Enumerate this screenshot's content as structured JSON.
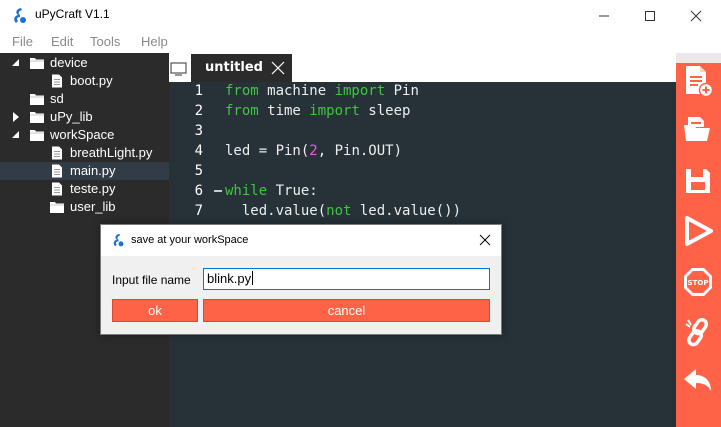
{
  "window": {
    "title": "uPyCraft V1.1"
  },
  "menu": {
    "items": [
      "File",
      "Edit",
      "Tools",
      "Help"
    ]
  },
  "tree": {
    "items": [
      {
        "label": "device",
        "type": "folder",
        "expanded": true,
        "level": 0
      },
      {
        "label": "boot.py",
        "type": "file",
        "level": 1
      },
      {
        "label": "sd",
        "type": "folder",
        "expanded": false,
        "level": 0,
        "no_arrow": true
      },
      {
        "label": "uPy_lib",
        "type": "folder",
        "expanded": false,
        "level": 0
      },
      {
        "label": "workSpace",
        "type": "folder",
        "expanded": true,
        "level": 0
      },
      {
        "label": "breathLight.py",
        "type": "file",
        "level": 1
      },
      {
        "label": "main.py",
        "type": "file",
        "level": 1,
        "selected": true
      },
      {
        "label": "teste.py",
        "type": "file",
        "level": 1
      },
      {
        "label": "user_lib",
        "type": "folder",
        "level": 1
      }
    ]
  },
  "editor": {
    "tab_label": "untitled",
    "lines": [
      {
        "num": "1",
        "parts": [
          [
            "kw",
            "from"
          ],
          [
            "",
            " machine "
          ],
          [
            "kw",
            "import"
          ],
          [
            "",
            " Pin"
          ]
        ]
      },
      {
        "num": "2",
        "parts": [
          [
            "kw",
            "from"
          ],
          [
            "",
            " time "
          ],
          [
            "kw",
            "import"
          ],
          [
            "",
            " sleep"
          ]
        ]
      },
      {
        "num": "3",
        "parts": []
      },
      {
        "num": "4",
        "parts": [
          [
            "",
            "led = Pin("
          ],
          [
            "num",
            "2"
          ],
          [
            "",
            ", Pin.OUT)"
          ]
        ]
      },
      {
        "num": "5",
        "parts": []
      },
      {
        "num": "6",
        "fold": true,
        "parts": [
          [
            "kw",
            "while"
          ],
          [
            "",
            " True:"
          ]
        ]
      },
      {
        "num": "7",
        "parts": [
          [
            "",
            "  led.value("
          ],
          [
            "kw",
            "not"
          ],
          [
            "",
            " led.value())"
          ]
        ]
      }
    ]
  },
  "toolbar": {
    "buttons": [
      "new-file",
      "open-file",
      "save-file",
      "run",
      "stop",
      "connect",
      "undo"
    ]
  },
  "dialog": {
    "title": "save at your workSpace",
    "input_label": "Input file name",
    "input_value": "blink.py",
    "ok_label": "ok",
    "cancel_label": "cancel"
  },
  "colors": {
    "accent": "#ff6347",
    "keyword": "#3ec63e",
    "number": "#e060e0",
    "editor_bg": "#263238",
    "tree_bg": "#2b2b2b"
  }
}
